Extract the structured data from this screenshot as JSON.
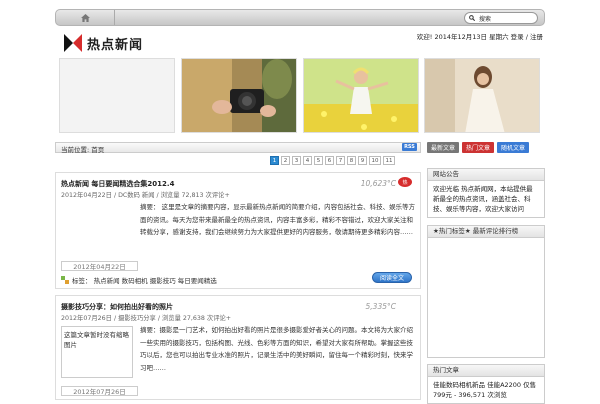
{
  "header": {
    "search_text": "搜索",
    "logo_text": "热点新闻",
    "datebar": "欢迎! 2014年12月13日 星期六   登录 / 注册"
  },
  "banner": [
    {
      "name": "banner-blank"
    },
    {
      "name": "banner-camera"
    },
    {
      "name": "banner-girl-flowers"
    },
    {
      "name": "banner-woman-field"
    }
  ],
  "section": {
    "label": "当前位置: 首页",
    "rss": "RSS"
  },
  "pagination": [
    "1",
    "2",
    "3",
    "4",
    "5",
    "6",
    "7",
    "8",
    "9",
    "10",
    "11"
  ],
  "pagination_active": "1",
  "posts": [
    {
      "title": "热点新闻 每日要闻精选合集2012.4",
      "meta": "2012年04月22日 / DC数码 新闻 / 浏览量 72,813 次评论+",
      "temp": "10,623°C",
      "badge": "热",
      "body": "摘要： 这里是文章的摘要内容，显示最新热点新闻的简要介绍，内容包括社会、科技、娱乐等方面的资讯。每天为您带来最新最全的热点资讯，内容丰富多彩，精彩不容错过，欢迎大家关注和转载分享，感谢支持，我们会继续努力为大家提供更好的内容服务，敬请期待更多精彩内容……",
      "date": "2012年04月22日",
      "tags": "标签： 热点新闻  数码相机  摄影技巧  每日要闻精选",
      "read": "阅读全文"
    },
    {
      "title": "摄影技巧分享：如何拍出好看的照片",
      "meta": "2012年07月26日 / 摄影技巧分享 / 浏览量 27,638 次评论+",
      "temp": "5,335°C",
      "thumb": "这篇文章暂时没有缩略图片",
      "body": "摘要：摄影是一门艺术，如何拍出好看的照片是很多摄影爱好者关心的问题。本文将为大家介绍一些实用的摄影技巧，包括构图、光线、色彩等方面的知识，希望对大家有所帮助。掌握这些技巧以后，您也可以拍出专业水准的照片，记录生活中的美好瞬间，留住每一个精彩时刻，快来学习吧……",
      "date": "2012年07月26日"
    }
  ],
  "sidebar": {
    "tabs": [
      {
        "label": "最新文章",
        "color": "#777777"
      },
      {
        "label": "热门文章",
        "color": "#cc3333"
      },
      {
        "label": "随机文章",
        "color": "#3a7bd5"
      }
    ],
    "notice_title": "网站公告",
    "notice_body": "欢迎光临 热点新闻网，本站提供最新最全的热点资讯，涵盖社会、科技、娱乐等内容，欢迎大家访问",
    "box2_title": "★热门标签★  最新评论排行榜",
    "box3_title": "热门文章",
    "box3_body": "佳能数码相机新品 佳能A2200 仅售799元 - 396,571 次浏览"
  }
}
